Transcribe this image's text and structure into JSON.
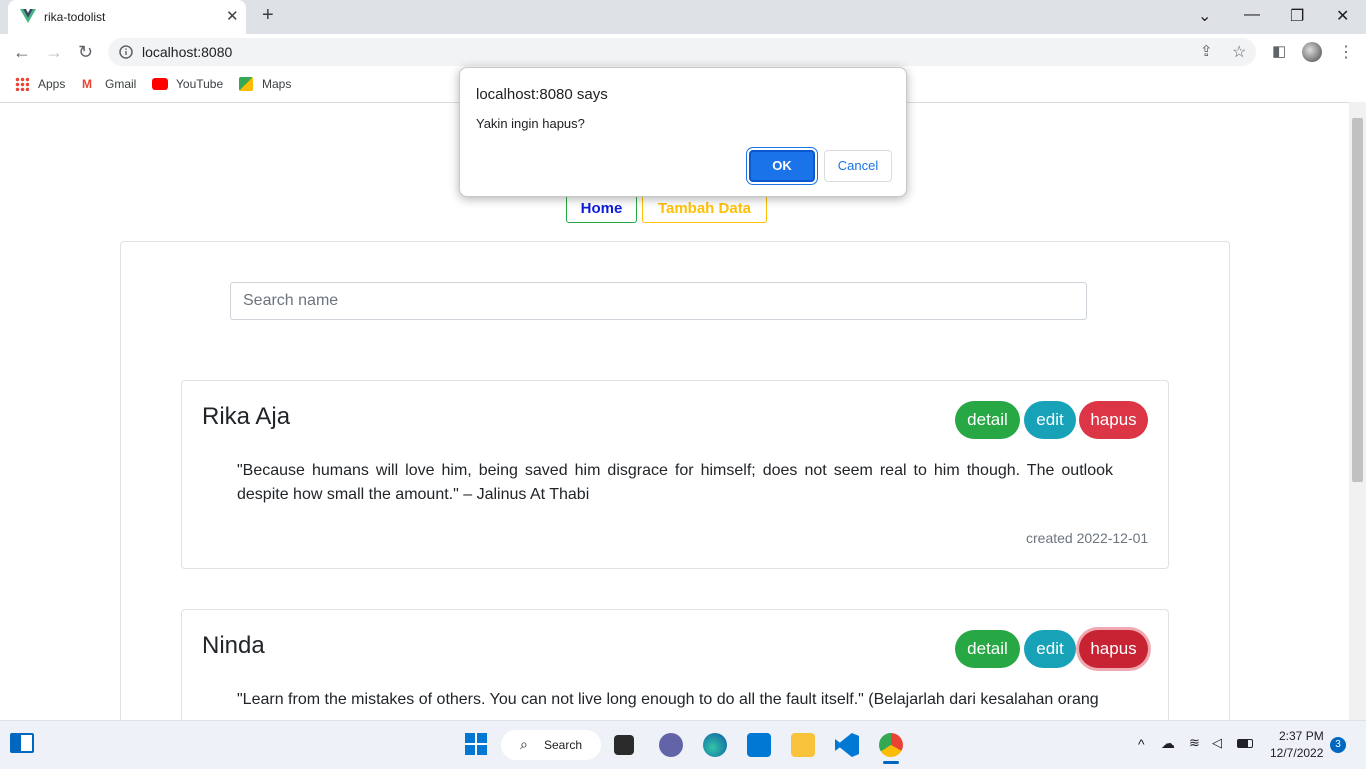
{
  "browser": {
    "tab_title": "rika-todolist",
    "url": "localhost:8080",
    "bookmarks": [
      "Apps",
      "Gmail",
      "YouTube",
      "Maps"
    ]
  },
  "nav": {
    "home": "Home",
    "add": "Tambah Data"
  },
  "search": {
    "placeholder": "Search name"
  },
  "cards": [
    {
      "name": "Rika Aja",
      "text": "\"Because humans will love him, being saved him disgrace for himself; does not seem real to him though. The outlook despite how small the amount.\" – Jalinus At Thabi",
      "created": "created 2022-12-01",
      "detail": "detail",
      "edit": "edit",
      "hapus": "hapus"
    },
    {
      "name": "Ninda",
      "text": "\"Learn from the mistakes of others. You can not live long enough to do all the fault itself.\" (Belajarlah dari kesalahan orang",
      "detail": "detail",
      "edit": "edit",
      "hapus": "hapus"
    }
  ],
  "dialog": {
    "title": "localhost:8080 says",
    "message": "Yakin ingin hapus?",
    "ok": "OK",
    "cancel": "Cancel"
  },
  "taskbar": {
    "search": "Search",
    "time": "2:37 PM",
    "date": "12/7/2022",
    "badge": "3"
  },
  "colors": {
    "success": "#28a745",
    "info": "#17a2b8",
    "danger": "#dc3545",
    "primary_link": "#0d1ddb",
    "warning": "#ffc107"
  }
}
